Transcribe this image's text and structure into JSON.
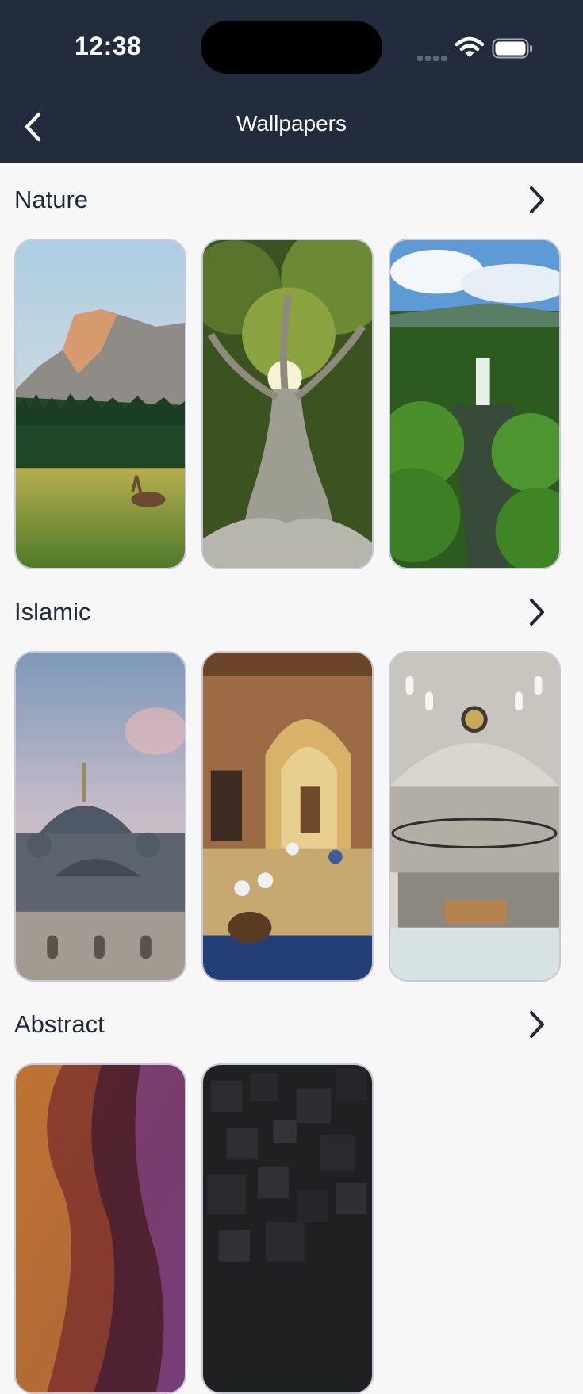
{
  "status_bar": {
    "time": "12:38"
  },
  "header": {
    "title": "Wallpapers",
    "back_icon": "chevron-left-icon"
  },
  "sections": [
    {
      "title": "Nature",
      "wallpapers": [
        "mountain-meadow-deer",
        "giant-tree",
        "forest-waterfall"
      ]
    },
    {
      "title": "Islamic",
      "wallpapers": [
        "mosque-domes-sunset",
        "mosque-prayer-hall",
        "mosque-interior-dome"
      ]
    },
    {
      "title": "Abstract",
      "wallpapers": [
        "orange-purple-waves",
        "dark-cubes"
      ]
    }
  ]
}
